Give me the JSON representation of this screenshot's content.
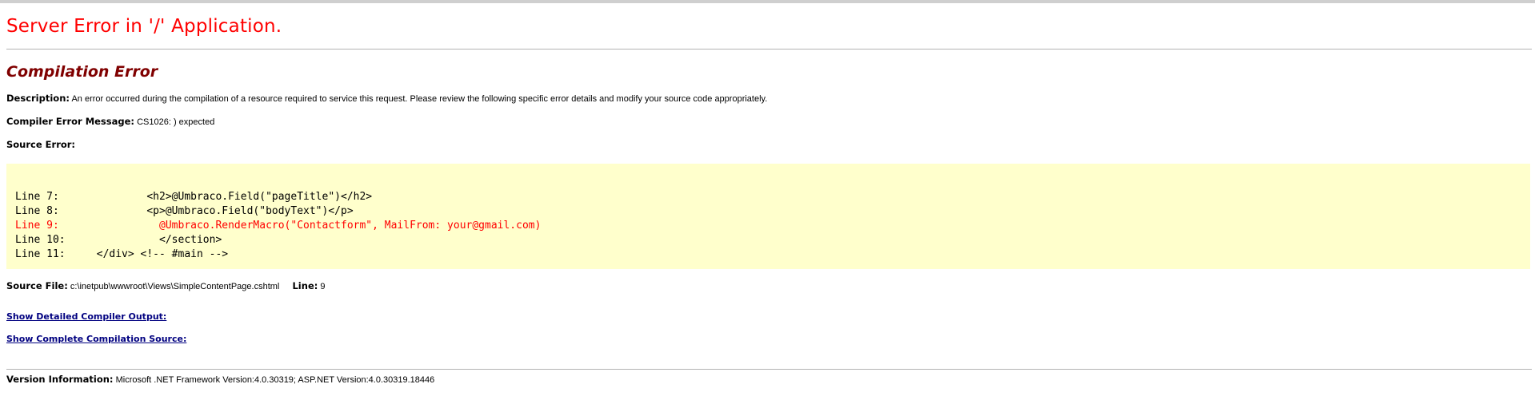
{
  "page": {
    "title": "Server Error in '/' Application.",
    "subtitle": "Compilation Error"
  },
  "description": {
    "label": "Description:",
    "text": "An error occurred during the compilation of a resource required to service this request. Please review the following specific error details and modify your source code appropriately."
  },
  "compiler_error": {
    "label": "Compiler Error Message:",
    "text": "CS1026: ) expected"
  },
  "source_error": {
    "label": "Source Error:",
    "lines": [
      "Line 7:              <h2>@Umbraco.Field(\"pageTitle\")</h2>",
      "Line 8:              <p>@Umbraco.Field(\"bodyText\")</p>",
      "Line 9:                @Umbraco.RenderMacro(\"Contactform\", MailFrom: your@gmail.com)",
      "Line 10:               </section>",
      "Line 11:     </div> <!-- #main -->"
    ],
    "error_line_index": 2
  },
  "source_file": {
    "label": "Source File:",
    "path": "c:\\inetpub\\wwwroot\\Views\\SimpleContentPage.cshtml",
    "line_label": "Line:",
    "line_value": "9"
  },
  "links": {
    "detailed_output": "Show Detailed Compiler Output:",
    "complete_source": "Show Complete Compilation Source:"
  },
  "version": {
    "label": "Version Information:",
    "text": "Microsoft .NET Framework Version:4.0.30319; ASP.NET Version:4.0.30319.18446"
  },
  "colors": {
    "title": "#ff0000",
    "subtitle": "#800000",
    "code_background": "#ffffcc",
    "error_line": "#ff0000",
    "link": "#000080"
  }
}
